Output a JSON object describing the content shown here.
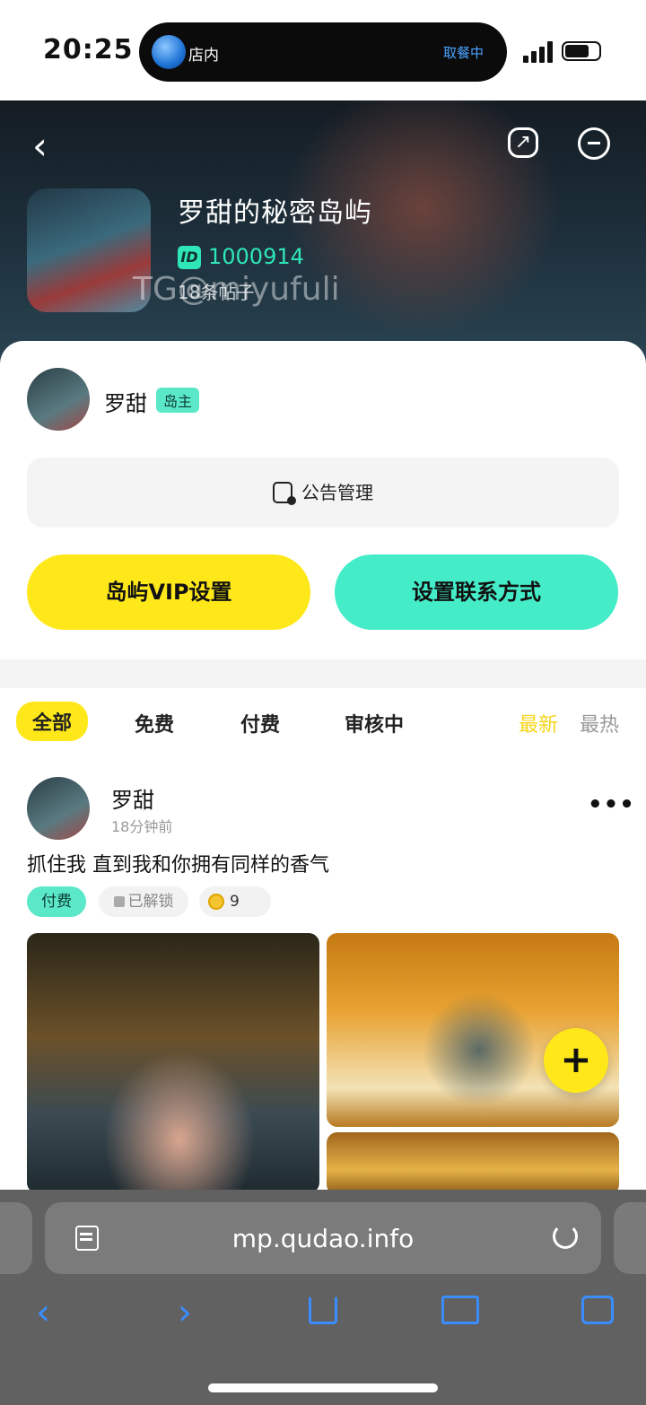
{
  "status_bar": {
    "time": "20:25",
    "island_left": "店内",
    "island_right": "取餐中"
  },
  "header": {
    "island_name": "罗甜的秘密岛屿",
    "id_badge": "ID",
    "id_value": "1000914",
    "post_count": "18条帖子",
    "watermark": "TG@miyufuli"
  },
  "owner": {
    "name": "罗甜",
    "badge": "岛主"
  },
  "actions": {
    "notice": "公告管理",
    "vip_settings": "岛屿VIP设置",
    "contact_settings": "设置联系方式"
  },
  "tabs": {
    "all": "全部",
    "free": "免费",
    "paid": "付费",
    "reviewing": "审核中",
    "sort_newest": "最新",
    "sort_hottest": "最热"
  },
  "post": {
    "author": "罗甜",
    "time": "18分钟前",
    "text": "抓住我 直到我和你拥有同样的香气",
    "tag_fee": "付费",
    "tag_unlocked": "已解锁",
    "coin_value": "9"
  },
  "fab_symbol": "+",
  "browser": {
    "url": "mp.qudao.info"
  },
  "colors": {
    "accent_yellow": "#ffe81a",
    "accent_teal": "#44ecc8",
    "id_green": "#2fe6b8",
    "ios_blue": "#3a8dff"
  },
  "icons": [
    "back-icon",
    "share-icon",
    "exit-icon",
    "notice-icon",
    "more-icon",
    "lock-icon",
    "coin-icon",
    "plus-icon",
    "reader-icon",
    "reload-icon",
    "tabs-icon",
    "bookmarks-icon"
  ]
}
